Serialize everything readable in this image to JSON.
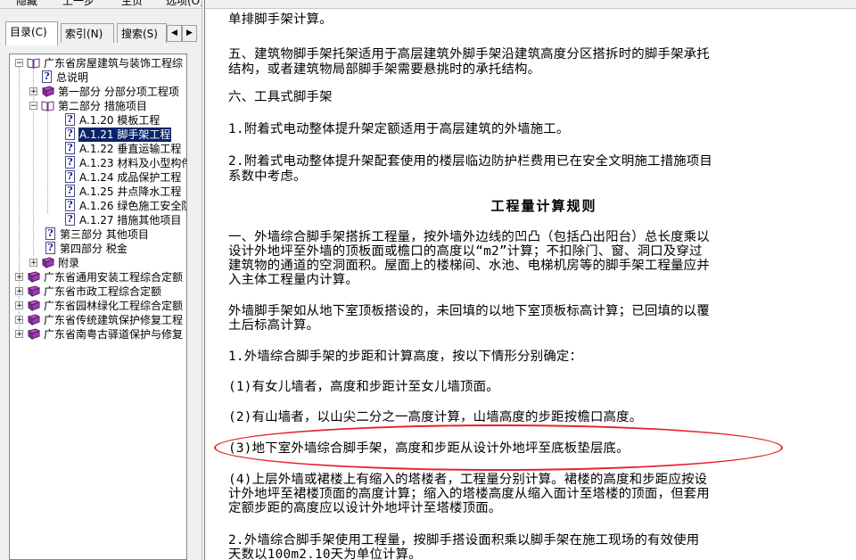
{
  "toolbar": {
    "items": [
      "隐藏",
      "上一步",
      "主页",
      "选项(O)"
    ]
  },
  "tabs": [
    {
      "label": "目录(C)",
      "active": true
    },
    {
      "label": "索引(N)",
      "active": false
    },
    {
      "label": "搜索(S)",
      "active": false
    }
  ],
  "tab_arrows": {
    "left": "◀",
    "right": "▶"
  },
  "tree": {
    "root": "广东省房屋建筑与装饰工程综",
    "summary": "总说明",
    "part1": "第一部分 分部分项工程项",
    "part2": "第二部分 措施项目",
    "items": [
      "A.1.20 模板工程",
      "A.1.21 脚手架工程",
      "A.1.22 垂直运输工程",
      "A.1.23 材料及小型构件",
      "A.1.24 成品保护工程",
      "A.1.25 井点降水工程",
      "A.1.26 绿色施工安全防",
      "A.1.27 措施其他项目"
    ],
    "selected_index": 1,
    "part3": "第三部分 其他项目",
    "part4": "第四部分 税金",
    "appendix": "附录",
    "others": [
      "广东省通用安装工程综合定额",
      "广东省市政工程综合定额",
      "广东省园林绿化工程综合定额",
      "广东省传统建筑保护修复工程",
      "广东省南粤古驿道保护与修复"
    ]
  },
  "content": {
    "lines": [
      "单排脚手架计算。",
      "五、建筑物脚手架托架适用于高层建筑外脚手架沿建筑高度分区搭拆时的脚手架承托",
      "结构，或者建筑物局部脚手架需要悬挑时的承托结构。",
      "六、工具式脚手架",
      "1.附着式电动整体提升架定额适用于高层建筑的外墙施工。",
      "2.附着式电动整体提升架配套使用的楼层临边防护栏费用已在安全文明施工措施项目",
      "系数中考虑。",
      "一、外墙综合脚手架搭拆工程量，按外墙外边线的凹凸（包括凸出阳台）总长度乘以",
      "设计外地坪至外墙的顶板面或檐口的高度以“m2”计算；不扣除门、窗、洞口及穿过",
      "建筑物的通道的空洞面积。屋面上的楼梯间、水池、电梯机房等的脚手架工程量应并",
      "入主体工程量内计算。",
      "外墙脚手架如从地下室顶板搭设的，未回填的以地下室顶板标高计算；已回填的以覆",
      "土后标高计算。",
      "1.外墙综合脚手架的步距和计算高度，按以下情形分别确定：",
      "(1)有女儿墙者，高度和步距计至女儿墙顶面。",
      "(2)有山墙者，以山尖二分之一高度计算，山墙高度的步距按檐口高度。",
      "(3)地下室外墙综合脚手架，高度和步距从设计外地坪至底板垫层底。",
      "(4)上层外墙或裙楼上有缩入的塔楼者，工程量分别计算。裙楼的高度和步距应按设",
      "计外地坪至裙楼顶面的高度计算；缩入的塔楼高度从缩入面计至塔楼的顶面，但套用",
      "定额步距的高度应以设计外地坪计至塔楼顶面。",
      "2.外墙综合脚手架使用工程量，按脚手搭设面积乘以脚手架在施工现场的有效使用",
      "天数以100m2.10天为单位计算。"
    ],
    "heading": "工程量计算规则"
  },
  "colors": {
    "selection": "#0a246a",
    "annotation": "#e8212b",
    "pane_bg": "#f0f0f0"
  }
}
